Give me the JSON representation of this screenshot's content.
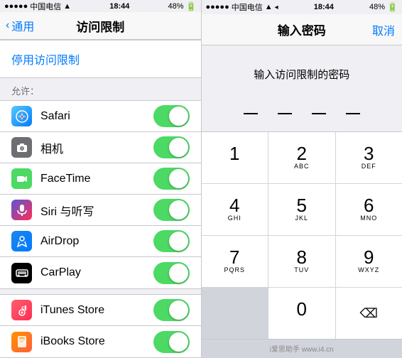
{
  "left": {
    "status": {
      "carrier": "中国电信",
      "time": "18:44",
      "battery": "48%"
    },
    "nav": {
      "back_label": "通用",
      "title": "访问限制"
    },
    "disable_btn": "停用访问限制",
    "section_header": "允许：",
    "items": [
      {
        "id": "safari",
        "label": "Safari",
        "icon_class": "icon-safari",
        "icon_char": "◎",
        "enabled": true
      },
      {
        "id": "camera",
        "label": "相机",
        "icon_class": "icon-camera",
        "icon_char": "📷",
        "enabled": true
      },
      {
        "id": "facetime",
        "label": "FaceTime",
        "icon_class": "icon-facetime",
        "icon_char": "📹",
        "enabled": true
      },
      {
        "id": "siri",
        "label": "Siri 与听写",
        "icon_class": "icon-siri",
        "icon_char": "🎤",
        "enabled": true
      },
      {
        "id": "airdrop",
        "label": "AirDrop",
        "icon_class": "icon-airdrop",
        "icon_char": "↑",
        "enabled": true
      },
      {
        "id": "carplay",
        "label": "CarPlay",
        "icon_class": "icon-carplay",
        "icon_char": "▶",
        "enabled": true
      }
    ],
    "items2": [
      {
        "id": "itunes",
        "label": "iTunes Store",
        "icon_class": "icon-itunes",
        "icon_char": "♪",
        "enabled": true
      },
      {
        "id": "ibooks",
        "label": "iBooks Store",
        "icon_class": "icon-ibooks",
        "icon_char": "📖",
        "enabled": true
      }
    ]
  },
  "right": {
    "status": {
      "carrier": "中国电信",
      "time": "18:44",
      "battery": "48%"
    },
    "nav": {
      "title": "输入密码",
      "cancel_label": "取消"
    },
    "prompt": "输入访问限制的密码",
    "keypad": [
      {
        "number": "1",
        "letters": ""
      },
      {
        "number": "2",
        "letters": "ABC"
      },
      {
        "number": "3",
        "letters": "DEF"
      },
      {
        "number": "4",
        "letters": "GHI"
      },
      {
        "number": "5",
        "letters": "JKL"
      },
      {
        "number": "6",
        "letters": "MNO"
      },
      {
        "number": "7",
        "letters": "PQRS"
      },
      {
        "number": "8",
        "letters": "TUV"
      },
      {
        "number": "9",
        "letters": "WXYZ"
      }
    ],
    "watermark": "i爱思助手\nwww.i4.cn"
  }
}
